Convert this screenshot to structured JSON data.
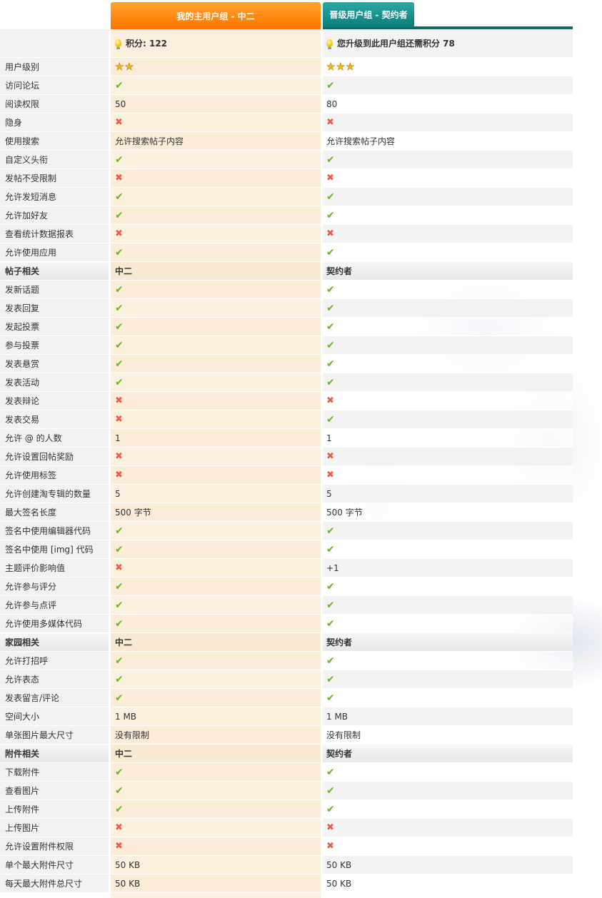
{
  "tabs": {
    "current_group": "我的主用户组 - 中二",
    "upgrade_group": "晋级用户组 - 契约者"
  },
  "header": {
    "current_points": "积分: 122",
    "upgrade_points_needed": "您升级到此用户组还需积分 78"
  },
  "colors": {
    "current_tab": "#ff7300",
    "upgrade_tab": "#0b7d7a",
    "check": "#6ab71a",
    "cross": "#f05a48"
  },
  "rows": [
    {
      "label": "用户级别",
      "type": "stars",
      "a": "2",
      "b": "3"
    },
    {
      "label": "访问论坛",
      "type": "flag",
      "a": "yes",
      "b": "yes"
    },
    {
      "label": "阅读权限",
      "type": "text",
      "a": "50",
      "b": "80"
    },
    {
      "label": "隐身",
      "type": "flag",
      "a": "no",
      "b": "no"
    },
    {
      "label": "使用搜索",
      "type": "text",
      "a": "允许搜索帖子内容",
      "b": "允许搜索帖子内容"
    },
    {
      "label": "自定义头衔",
      "type": "flag",
      "a": "yes",
      "b": "yes"
    },
    {
      "label": "发帖不受限制",
      "type": "flag",
      "a": "no",
      "b": "no"
    },
    {
      "label": "允许发短消息",
      "type": "flag",
      "a": "yes",
      "b": "yes"
    },
    {
      "label": "允许加好友",
      "type": "flag",
      "a": "yes",
      "b": "yes"
    },
    {
      "label": "查看统计数据报表",
      "type": "flag",
      "a": "no",
      "b": "no"
    },
    {
      "label": "允许使用应用",
      "type": "flag",
      "a": "yes",
      "b": "yes"
    },
    {
      "label": "帖子相关",
      "type": "section",
      "a": "中二",
      "b": "契约者"
    },
    {
      "label": "发新话题",
      "type": "flag",
      "a": "yes",
      "b": "yes"
    },
    {
      "label": "发表回复",
      "type": "flag",
      "a": "yes",
      "b": "yes"
    },
    {
      "label": "发起投票",
      "type": "flag",
      "a": "yes",
      "b": "yes"
    },
    {
      "label": "参与投票",
      "type": "flag",
      "a": "yes",
      "b": "yes"
    },
    {
      "label": "发表悬赏",
      "type": "flag",
      "a": "yes",
      "b": "yes"
    },
    {
      "label": "发表活动",
      "type": "flag",
      "a": "yes",
      "b": "yes"
    },
    {
      "label": "发表辩论",
      "type": "flag",
      "a": "no",
      "b": "no"
    },
    {
      "label": "发表交易",
      "type": "flag",
      "a": "no",
      "b": "yes"
    },
    {
      "label": "允许 @ 的人数",
      "type": "text",
      "a": "1",
      "b": "1"
    },
    {
      "label": "允许设置回帖奖励",
      "type": "flag",
      "a": "no",
      "b": "no"
    },
    {
      "label": "允许使用标签",
      "type": "flag",
      "a": "no",
      "b": "no"
    },
    {
      "label": "允许创建淘专辑的数量",
      "type": "text",
      "a": "5",
      "b": "5"
    },
    {
      "label": "最大签名长度",
      "type": "text",
      "a": "500 字节",
      "b": "500 字节"
    },
    {
      "label": "签名中使用编辑器代码",
      "type": "flag",
      "a": "yes",
      "b": "yes"
    },
    {
      "label": "签名中使用 [img] 代码",
      "type": "flag",
      "a": "yes",
      "b": "yes"
    },
    {
      "label": "主题评价影响值",
      "type": "mixed",
      "a": "no",
      "b": "+1"
    },
    {
      "label": "允许参与评分",
      "type": "flag",
      "a": "yes",
      "b": "yes"
    },
    {
      "label": "允许参与点评",
      "type": "flag",
      "a": "yes",
      "b": "yes"
    },
    {
      "label": "允许使用多媒体代码",
      "type": "flag",
      "a": "yes",
      "b": "yes"
    },
    {
      "label": "家园相关",
      "type": "section",
      "a": "中二",
      "b": "契约者"
    },
    {
      "label": "允许打招呼",
      "type": "flag",
      "a": "yes",
      "b": "yes"
    },
    {
      "label": "允许表态",
      "type": "flag",
      "a": "yes",
      "b": "yes"
    },
    {
      "label": "发表留言/评论",
      "type": "flag",
      "a": "yes",
      "b": "yes"
    },
    {
      "label": "空间大小",
      "type": "text",
      "a": "1 MB",
      "b": "1 MB"
    },
    {
      "label": "单张图片最大尺寸",
      "type": "text",
      "a": "没有限制",
      "b": "没有限制"
    },
    {
      "label": "附件相关",
      "type": "section",
      "a": "中二",
      "b": "契约者"
    },
    {
      "label": "下载附件",
      "type": "flag",
      "a": "yes",
      "b": "yes"
    },
    {
      "label": "查看图片",
      "type": "flag",
      "a": "yes",
      "b": "yes"
    },
    {
      "label": "上传附件",
      "type": "flag",
      "a": "yes",
      "b": "yes"
    },
    {
      "label": "上传图片",
      "type": "flag",
      "a": "no",
      "b": "no"
    },
    {
      "label": "允许设置附件权限",
      "type": "flag",
      "a": "no",
      "b": "no"
    },
    {
      "label": "单个最大附件尺寸",
      "type": "text",
      "a": "50 KB",
      "b": "50 KB"
    },
    {
      "label": "每天最大附件总尺寸",
      "type": "text",
      "a": "50 KB",
      "b": "50 KB"
    }
  ]
}
